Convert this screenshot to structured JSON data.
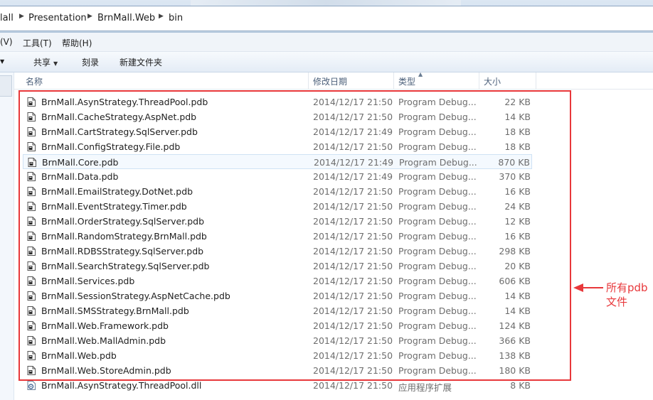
{
  "breadcrumb": {
    "items": [
      "lall",
      "Presentation",
      "BrnMall.Web",
      "bin"
    ]
  },
  "menu": {
    "items": [
      "(V)",
      "工具(T)",
      "帮助(H)"
    ]
  },
  "toolbar": {
    "share_label": "共享",
    "burn_label": "刻录",
    "new_folder_label": "新建文件夹"
  },
  "columns": {
    "name": "名称",
    "date": "修改日期",
    "type": "类型",
    "size": "大小"
  },
  "files": [
    {
      "name": "BrnMall.AsynStrategy.ThreadPool.pdb",
      "date": "2014/12/17 21:50",
      "type": "Program Debug...",
      "size": "22 KB",
      "icon": "pdb-file-icon"
    },
    {
      "name": "BrnMall.CacheStrategy.AspNet.pdb",
      "date": "2014/12/17 21:50",
      "type": "Program Debug...",
      "size": "14 KB",
      "icon": "pdb-file-icon"
    },
    {
      "name": "BrnMall.CartStrategy.SqlServer.pdb",
      "date": "2014/12/17 21:49",
      "type": "Program Debug...",
      "size": "18 KB",
      "icon": "pdb-file-icon"
    },
    {
      "name": "BrnMall.ConfigStrategy.File.pdb",
      "date": "2014/12/17 21:50",
      "type": "Program Debug...",
      "size": "18 KB",
      "icon": "pdb-file-icon"
    },
    {
      "name": "BrnMall.Core.pdb",
      "date": "2014/12/17 21:49",
      "type": "Program Debug...",
      "size": "870 KB",
      "icon": "pdb-file-icon",
      "selected": true
    },
    {
      "name": "BrnMall.Data.pdb",
      "date": "2014/12/17 21:49",
      "type": "Program Debug...",
      "size": "370 KB",
      "icon": "pdb-file-icon"
    },
    {
      "name": "BrnMall.EmailStrategy.DotNet.pdb",
      "date": "2014/12/17 21:50",
      "type": "Program Debug...",
      "size": "16 KB",
      "icon": "pdb-file-icon"
    },
    {
      "name": "BrnMall.EventStrategy.Timer.pdb",
      "date": "2014/12/17 21:50",
      "type": "Program Debug...",
      "size": "24 KB",
      "icon": "pdb-file-icon"
    },
    {
      "name": "BrnMall.OrderStrategy.SqlServer.pdb",
      "date": "2014/12/17 21:50",
      "type": "Program Debug...",
      "size": "12 KB",
      "icon": "pdb-file-icon"
    },
    {
      "name": "BrnMall.RandomStrategy.BrnMall.pdb",
      "date": "2014/12/17 21:50",
      "type": "Program Debug...",
      "size": "16 KB",
      "icon": "pdb-file-icon"
    },
    {
      "name": "BrnMall.RDBSStrategy.SqlServer.pdb",
      "date": "2014/12/17 21:50",
      "type": "Program Debug...",
      "size": "298 KB",
      "icon": "pdb-file-icon"
    },
    {
      "name": "BrnMall.SearchStrategy.SqlServer.pdb",
      "date": "2014/12/17 21:50",
      "type": "Program Debug...",
      "size": "20 KB",
      "icon": "pdb-file-icon"
    },
    {
      "name": "BrnMall.Services.pdb",
      "date": "2014/12/17 21:50",
      "type": "Program Debug...",
      "size": "606 KB",
      "icon": "pdb-file-icon"
    },
    {
      "name": "BrnMall.SessionStrategy.AspNetCache.pdb",
      "date": "2014/12/17 21:50",
      "type": "Program Debug...",
      "size": "14 KB",
      "icon": "pdb-file-icon"
    },
    {
      "name": "BrnMall.SMSStrategy.BrnMall.pdb",
      "date": "2014/12/17 21:50",
      "type": "Program Debug...",
      "size": "14 KB",
      "icon": "pdb-file-icon"
    },
    {
      "name": "BrnMall.Web.Framework.pdb",
      "date": "2014/12/17 21:50",
      "type": "Program Debug...",
      "size": "124 KB",
      "icon": "pdb-file-icon"
    },
    {
      "name": "BrnMall.Web.MallAdmin.pdb",
      "date": "2014/12/17 21:50",
      "type": "Program Debug...",
      "size": "366 KB",
      "icon": "pdb-file-icon"
    },
    {
      "name": "BrnMall.Web.pdb",
      "date": "2014/12/17 21:50",
      "type": "Program Debug...",
      "size": "138 KB",
      "icon": "pdb-file-icon"
    },
    {
      "name": "BrnMall.Web.StoreAdmin.pdb",
      "date": "2014/12/17 21:50",
      "type": "Program Debug...",
      "size": "180 KB",
      "icon": "pdb-file-icon"
    },
    {
      "name": "BrnMall.AsynStrategy.ThreadPool.dll",
      "date": "2014/12/17 21:50",
      "type": "应用程序扩展",
      "size": "8 KB",
      "icon": "dll-file-icon"
    }
  ],
  "annotation": {
    "text": "所有pdb文件",
    "color": "#e8383b"
  },
  "colors": {
    "accent": "#e8383b",
    "header_text": "#4c607a",
    "secondary_text": "#6d6d6d"
  }
}
